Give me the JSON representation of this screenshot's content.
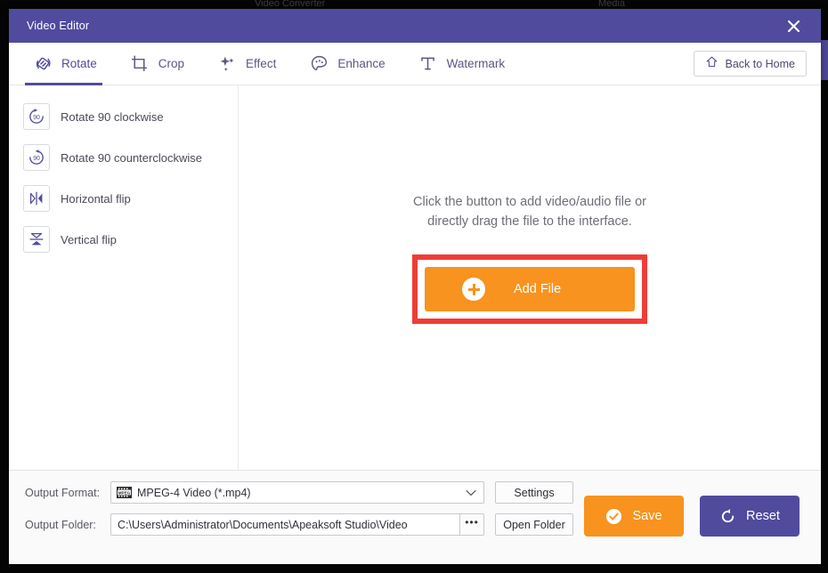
{
  "backdrop": {
    "text_left": "Video Converter",
    "text_right": "Media"
  },
  "window": {
    "title": "Video Editor",
    "close_icon": "close-icon"
  },
  "tabs": [
    {
      "label": "Rotate",
      "icon": "rotate-icon",
      "active": true
    },
    {
      "label": "Crop",
      "icon": "crop-icon",
      "active": false
    },
    {
      "label": "Effect",
      "icon": "sparkle-icon",
      "active": false
    },
    {
      "label": "Enhance",
      "icon": "palette-icon",
      "active": false
    },
    {
      "label": "Watermark",
      "icon": "text-t-icon",
      "active": false
    }
  ],
  "back_to_home": {
    "label": "Back to Home",
    "icon": "home-icon"
  },
  "sidebar": {
    "items": [
      {
        "label": "Rotate 90 clockwise",
        "icon": "rotate-cw-90-icon"
      },
      {
        "label": "Rotate 90 counterclockwise",
        "icon": "rotate-ccw-90-icon"
      },
      {
        "label": "Horizontal flip",
        "icon": "flip-horizontal-icon"
      },
      {
        "label": "Vertical flip",
        "icon": "flip-vertical-icon"
      }
    ]
  },
  "canvas": {
    "hint_line1": "Click the button to add video/audio file or",
    "hint_line2": "directly drag the file to the interface.",
    "add_file_label": "Add File",
    "add_file_icon": "plus-circle-icon",
    "highlight_color": "#f03c36"
  },
  "bottom": {
    "output_format_label": "Output Format:",
    "output_format_value": "MPEG-4 Video (*.mp4)",
    "output_format_icon": "film-strip-icon",
    "settings_label": "Settings",
    "output_folder_label": "Output Folder:",
    "output_folder_value": "C:\\Users\\Administrator\\Documents\\Apeaksoft Studio\\Video",
    "browse_label": "•••",
    "open_folder_label": "Open Folder",
    "save_label": "Save",
    "save_icon": "check-circle-icon",
    "reset_label": "Reset",
    "reset_icon": "refresh-icon"
  },
  "colors": {
    "brand_purple": "#514b9e",
    "accent_orange": "#f7931e",
    "highlight_red": "#f03c36"
  }
}
